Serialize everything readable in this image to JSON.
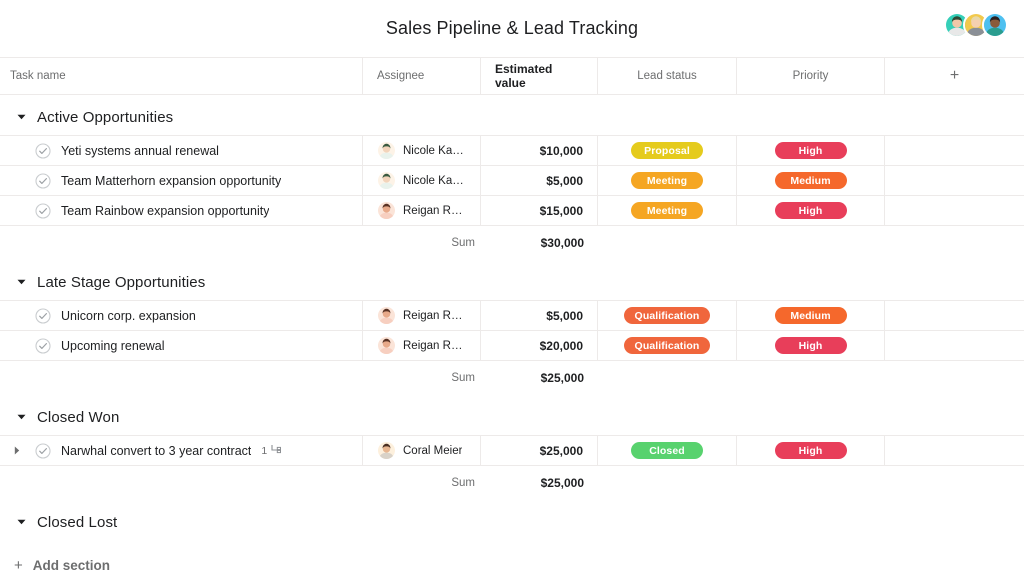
{
  "header": {
    "title": "Sales Pipeline & Lead Tracking",
    "avatars": [
      {
        "name": "avatar-teal",
        "bg": "#35cfb8",
        "skin": "#f0c7a8",
        "hair": "#2f4a35",
        "shirt": "#e8e8e8"
      },
      {
        "name": "avatar-yellow",
        "bg": "#f2c94c",
        "skin": "#f5d0b0",
        "hair": "#e8d8a8",
        "shirt": "#8a8f96"
      },
      {
        "name": "avatar-blue",
        "bg": "#4ec0f0",
        "skin": "#8a5a3a",
        "hair": "#2a2020",
        "shirt": "#2a9d8f"
      }
    ]
  },
  "columns": [
    {
      "key": "task",
      "label": "Task name"
    },
    {
      "key": "assignee",
      "label": "Assignee"
    },
    {
      "key": "value",
      "label": "Estimated value"
    },
    {
      "key": "status",
      "label": "Lead status"
    },
    {
      "key": "priority",
      "label": "Priority"
    },
    {
      "key": "add",
      "label": "+"
    }
  ],
  "pill_colors": {
    "Proposal": "#e5cb1d",
    "Meeting": "#f5a623",
    "Qualification": "#f0663c",
    "Closed": "#58d26e",
    "High": "#e83e5a",
    "Medium": "#f5682c"
  },
  "sections": [
    {
      "title": "Active Opportunities",
      "expanded": true,
      "sum_label": "Sum",
      "sum_value": "$30,000",
      "rows": [
        {
          "name": "Yeti systems annual renewal",
          "assignee": "Nicole Kaptur",
          "avatar": {
            "bg": "#fdf3e7",
            "skin": "#f3d4bb",
            "hair": "#3a5a40",
            "shirt": "#e9f2ec"
          },
          "value": "$10,000",
          "status": "Proposal",
          "priority": "High",
          "subtasks": null,
          "expandable": false
        },
        {
          "name": "Team Matterhorn expansion opportunity",
          "assignee": "Nicole Kaptur",
          "avatar": {
            "bg": "#fdf3e7",
            "skin": "#f3d4bb",
            "hair": "#3a5a40",
            "shirt": "#e9f2ec"
          },
          "value": "$5,000",
          "status": "Meeting",
          "priority": "Medium",
          "subtasks": null,
          "expandable": false
        },
        {
          "name": "Team Rainbow expansion opportunity",
          "assignee": "Reigan Reach",
          "avatar": {
            "bg": "#fbe4d8",
            "skin": "#e8a989",
            "hair": "#5a3224",
            "shirt": "#f7cfc0"
          },
          "value": "$15,000",
          "status": "Meeting",
          "priority": "High",
          "subtasks": null,
          "expandable": false
        }
      ]
    },
    {
      "title": "Late Stage Opportunities",
      "expanded": true,
      "sum_label": "Sum",
      "sum_value": "$25,000",
      "rows": [
        {
          "name": "Unicorn corp. expansion",
          "assignee": "Reigan Reach",
          "avatar": {
            "bg": "#fbe4d8",
            "skin": "#e8a989",
            "hair": "#5a3224",
            "shirt": "#f7cfc0"
          },
          "value": "$5,000",
          "status": "Qualification",
          "priority": "Medium",
          "subtasks": null,
          "expandable": false
        },
        {
          "name": "Upcoming renewal",
          "assignee": "Reigan Reach",
          "avatar": {
            "bg": "#fbe4d8",
            "skin": "#e8a989",
            "hair": "#5a3224",
            "shirt": "#f7cfc0"
          },
          "value": "$20,000",
          "status": "Qualification",
          "priority": "High",
          "subtasks": null,
          "expandable": false
        }
      ]
    },
    {
      "title": "Closed Won",
      "expanded": true,
      "sum_label": "Sum",
      "sum_value": "$25,000",
      "rows": [
        {
          "name": "Narwhal convert to 3 year contract",
          "assignee": "Coral Meier",
          "avatar": {
            "bg": "#fdf0dd",
            "skin": "#e8b690",
            "hair": "#4a2f22",
            "shirt": "#d9d2c8"
          },
          "value": "$25,000",
          "status": "Closed",
          "priority": "High",
          "subtasks": "1",
          "expandable": true
        }
      ]
    },
    {
      "title": "Closed Lost",
      "expanded": true,
      "sum_label": null,
      "sum_value": null,
      "rows": []
    }
  ],
  "footer": {
    "add_section_label": "Add section",
    "add_section_plus": "+"
  }
}
